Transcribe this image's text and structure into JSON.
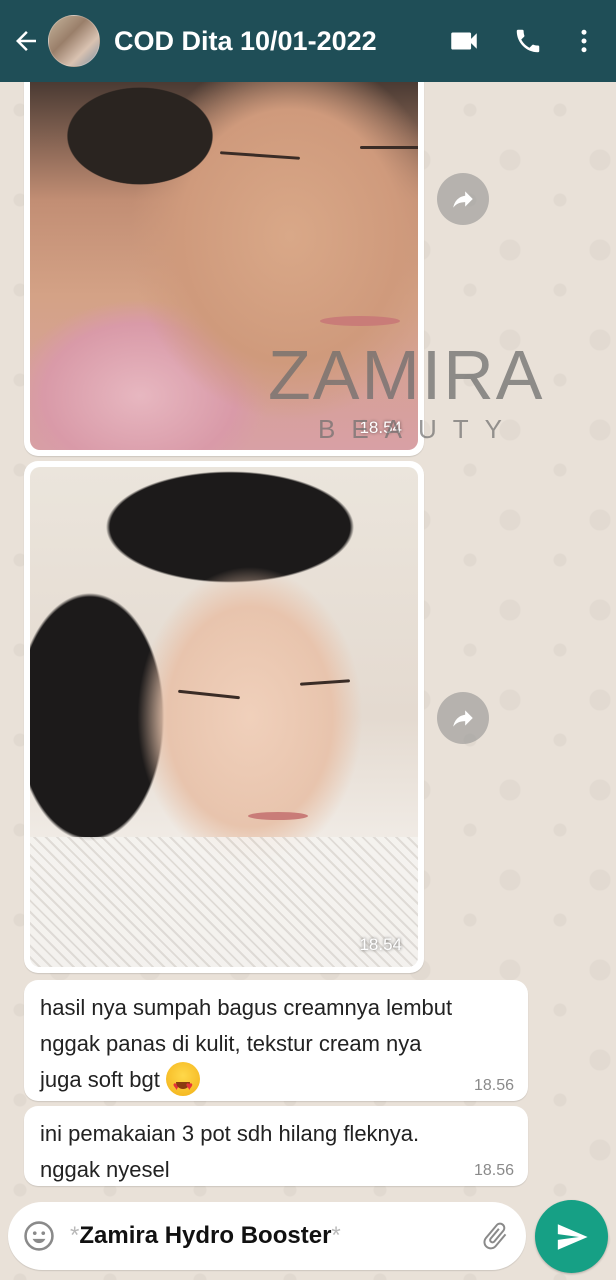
{
  "header": {
    "title": "COD Dita 10/01-2022",
    "avatar_icon": "contact-avatar",
    "back_icon": "arrow-left-icon",
    "video_icon": "video-camera-icon",
    "call_icon": "phone-icon",
    "menu_icon": "more-vertical-icon",
    "bg_color": "#1f4e57"
  },
  "messages": {
    "image1": {
      "time": "18.54"
    },
    "image2": {
      "time": "18.54"
    },
    "text1": {
      "line1": "hasil nya sumpah bagus creamnya lembut",
      "line2": "nggak panas di kulit, tekstur cream nya",
      "line3": "juga soft bgt",
      "emoji": "heart-eyes-emoji",
      "time": "18.56"
    },
    "text2": {
      "line1": "ini pemakaian 3 pot sdh hilang fleknya.",
      "line2": "nggak nyesel",
      "time": "18.56"
    }
  },
  "watermark": {
    "main": "ZAMIRA",
    "sub": "BEAUTY"
  },
  "composer": {
    "star_left": "*",
    "text": "Zamira Hydro Booster",
    "star_right": "*",
    "emoji_icon": "smiley-icon",
    "attach_icon": "paperclip-icon",
    "send_icon": "send-icon",
    "send_color": "#16a085"
  }
}
